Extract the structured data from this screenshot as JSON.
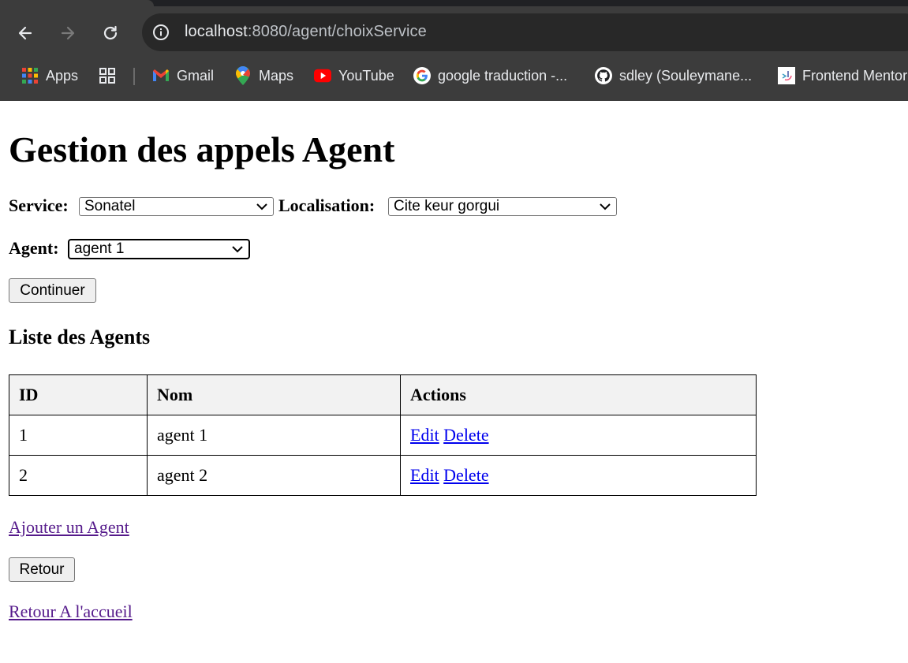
{
  "browser": {
    "url_host": "localhost",
    "url_rest": ":8080/agent/choixService",
    "bookmarks": [
      {
        "label": "Apps",
        "icon": "apps-grid-icon"
      },
      {
        "label": "",
        "icon": "tab-groups-icon"
      },
      {
        "label": "Gmail",
        "icon": "gmail-icon"
      },
      {
        "label": "Maps",
        "icon": "maps-icon"
      },
      {
        "label": "YouTube",
        "icon": "youtube-icon"
      },
      {
        "label": "google traduction -...",
        "icon": "google-icon"
      },
      {
        "label": "sdley (Souleymane...",
        "icon": "github-icon"
      },
      {
        "label": "Frontend Mentor",
        "icon": "frontend-mentor-icon"
      }
    ]
  },
  "page": {
    "title": "Gestion des appels Agent",
    "form": {
      "service_label": "Service:",
      "service_value": "Sonatel",
      "localisation_label": "Localisation:",
      "localisation_value": "Cite keur gorgui",
      "agent_label": "Agent:",
      "agent_value": "agent 1",
      "continue_label": "Continuer"
    },
    "list_title": "Liste des Agents",
    "table": {
      "headers": [
        "ID",
        "Nom",
        "Actions"
      ],
      "rows": [
        {
          "id": "1",
          "nom": "agent 1",
          "edit": "Edit",
          "delete": "Delete"
        },
        {
          "id": "2",
          "nom": "agent 2",
          "edit": "Edit",
          "delete": "Delete"
        }
      ]
    },
    "add_link": "Ajouter un Agent",
    "back_button": "Retour",
    "home_link": "Retour A l'accueil"
  }
}
